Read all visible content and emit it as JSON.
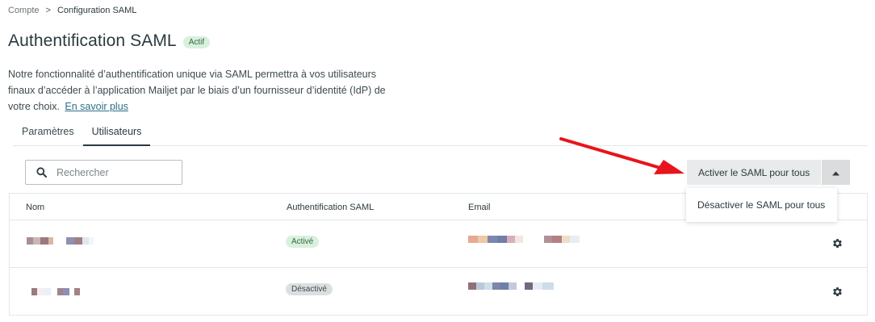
{
  "breadcrumb": {
    "parent": "Compte",
    "separator": ">",
    "current": "Configuration SAML"
  },
  "header": {
    "title": "Authentification SAML",
    "status": "Actif"
  },
  "description": {
    "text": "Notre fonctionnalité d’authentification unique via SAML permettra à vos utilisateurs finaux d’accéder à l’application Mailjet par le biais d’un fournisseur d’identité (IdP) de votre choix.",
    "link": "En savoir plus"
  },
  "tabs": [
    {
      "label": "Paramètres",
      "active": false
    },
    {
      "label": "Utilisateurs",
      "active": true
    }
  ],
  "search": {
    "placeholder": "Rechercher",
    "value": ""
  },
  "actions": {
    "main_label": "Activer le SAML pour tous",
    "menu_items": [
      "Désactiver le SAML pour tous"
    ]
  },
  "table": {
    "columns": [
      "Nom",
      "Authentification SAML",
      "Email"
    ],
    "rows": [
      {
        "name": "",
        "saml_status": "Activé",
        "email": ""
      },
      {
        "name": "",
        "saml_status": "Désactivé",
        "email": ""
      }
    ]
  },
  "colors": {
    "accent": "#2b3a3f",
    "link": "#2d6f86",
    "status_active_bg": "#d9f0de",
    "status_inactive_bg": "#dcdfe0",
    "annotation_arrow": "#e8141b"
  },
  "icons": {
    "search": "search-icon",
    "toggle": "caret-up-icon",
    "row_action": "gear-icon",
    "annotation": "red-arrow-annotation"
  }
}
